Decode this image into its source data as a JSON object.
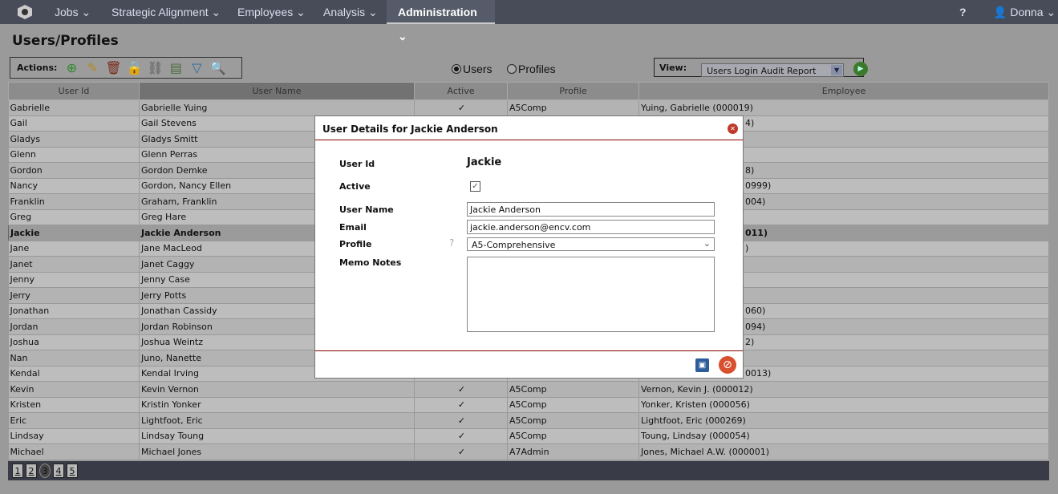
{
  "nav": {
    "items": [
      "Jobs",
      "Strategic Alignment",
      "Employees",
      "Analysis",
      "Administration"
    ],
    "active": "Administration",
    "help": "?",
    "user": "Donna"
  },
  "page": {
    "title": "Users/Profiles"
  },
  "actions": {
    "label": "Actions:",
    "icons": [
      "add-icon",
      "edit-icon",
      "delete-icon",
      "lock-icon",
      "link-icon",
      "print-icon",
      "filter-icon",
      "search-icon"
    ]
  },
  "mode": {
    "users": "Users",
    "profiles": "Profiles",
    "selected": "Users"
  },
  "view": {
    "label": "View:",
    "selected": "Users Login Audit Report"
  },
  "table": {
    "headers": [
      "User Id",
      "User Name",
      "Active",
      "Profile",
      "Employee"
    ],
    "rows": [
      {
        "id": "Gabrielle",
        "name": "Gabrielle Yuing",
        "active": "✓",
        "profile": "A5Comp",
        "employee": "Yuing, Gabrielle (000019)"
      },
      {
        "id": "Gail",
        "name": "Gail Stevens",
        "active": "",
        "profile": "",
        "frag": "4)"
      },
      {
        "id": "Gladys",
        "name": "Gladys Smitt",
        "active": "",
        "profile": "",
        "frag": ""
      },
      {
        "id": "Glenn",
        "name": "Glenn Perras",
        "active": "",
        "profile": "",
        "frag": ""
      },
      {
        "id": "Gordon",
        "name": "Gordon Demke",
        "active": "",
        "profile": "",
        "frag": "8)"
      },
      {
        "id": "Nancy",
        "name": "Gordon, Nancy Ellen",
        "active": "",
        "profile": "",
        "frag": "0999)"
      },
      {
        "id": "Franklin",
        "name": "Graham, Franklin",
        "active": "",
        "profile": "",
        "frag": "004)"
      },
      {
        "id": "Greg",
        "name": "Greg Hare",
        "active": "",
        "profile": "",
        "frag": ""
      },
      {
        "id": "Jackie",
        "name": "Jackie Anderson",
        "active": "",
        "profile": "",
        "frag": "011)"
      },
      {
        "id": "Jane",
        "name": "Jane MacLeod",
        "active": "",
        "profile": "",
        "frag": ")"
      },
      {
        "id": "Janet",
        "name": "Janet Caggy",
        "active": "",
        "profile": "",
        "frag": ""
      },
      {
        "id": "Jenny",
        "name": "Jenny Case",
        "active": "",
        "profile": "",
        "frag": ""
      },
      {
        "id": "Jerry",
        "name": "Jerry Potts",
        "active": "",
        "profile": "",
        "frag": ""
      },
      {
        "id": "Jonathan",
        "name": "Jonathan Cassidy",
        "active": "",
        "profile": "",
        "frag": "060)"
      },
      {
        "id": "Jordan",
        "name": "Jordan Robinson",
        "active": "",
        "profile": "",
        "frag": "094)"
      },
      {
        "id": "Joshua",
        "name": "Joshua Weintz",
        "active": "",
        "profile": "",
        "frag": "2)"
      },
      {
        "id": "Nan",
        "name": "Juno, Nanette",
        "active": "",
        "profile": "",
        "frag": ""
      },
      {
        "id": "Kendal",
        "name": "Kendal Irving",
        "active": "",
        "profile": "",
        "frag": "0013)"
      },
      {
        "id": "Kevin",
        "name": "Kevin Vernon",
        "active": "✓",
        "profile": "A5Comp",
        "employee": "Vernon, Kevin J. (000012)"
      },
      {
        "id": "Kristen",
        "name": "Kristin Yonker",
        "active": "✓",
        "profile": "A5Comp",
        "employee": "Yonker, Kristen (000056)"
      },
      {
        "id": "Eric",
        "name": "Lightfoot, Eric",
        "active": "✓",
        "profile": "A5Comp",
        "employee": "Lightfoot, Eric (000269)"
      },
      {
        "id": "Lindsay",
        "name": "Lindsay Toung",
        "active": "✓",
        "profile": "A5Comp",
        "employee": "Toung, Lindsay (000054)"
      },
      {
        "id": "Michael",
        "name": "Michael Jones",
        "active": "✓",
        "profile": "A7Admin",
        "employee": "Jones, Michael A.W. (000001)"
      }
    ],
    "selected_row": "Jackie"
  },
  "pagination": {
    "pages": [
      "1",
      "2",
      "3",
      "4",
      "5"
    ],
    "current": "3"
  },
  "modal": {
    "title": "User Details for Jackie Anderson",
    "user_id_label": "User Id",
    "user_id": "Jackie",
    "active_label": "Active",
    "active": true,
    "user_name_label": "User Name",
    "user_name": "Jackie Anderson",
    "email_label": "Email",
    "email": "jackie.anderson@encv.com",
    "profile_label": "Profile",
    "profile": "A5-Comprehensive",
    "memo_label": "Memo Notes",
    "memo": ""
  }
}
